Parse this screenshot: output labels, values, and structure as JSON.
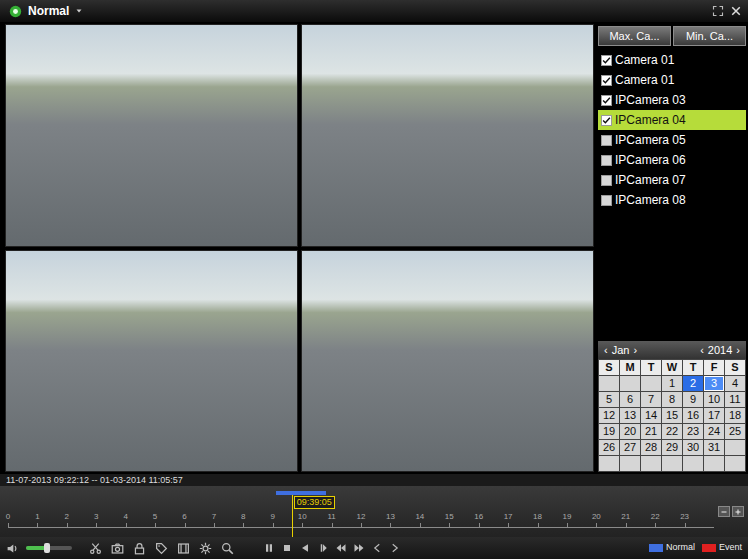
{
  "title_bar": {
    "mode": "Normal"
  },
  "camera_buttons": [
    "Max. Ca...",
    "Min. Ca..."
  ],
  "cameras": [
    {
      "label": "Camera 01",
      "checked": true,
      "selected": false
    },
    {
      "label": "Camera 01",
      "checked": true,
      "selected": false
    },
    {
      "label": "IPCamera 03",
      "checked": true,
      "selected": false
    },
    {
      "label": "IPCamera 04",
      "checked": true,
      "selected": true
    },
    {
      "label": "IPCamera 05",
      "checked": false,
      "selected": false
    },
    {
      "label": "IPCamera 06",
      "checked": false,
      "selected": false
    },
    {
      "label": "IPCamera 07",
      "checked": false,
      "selected": false
    },
    {
      "label": "IPCamera 08",
      "checked": false,
      "selected": false
    }
  ],
  "calendar": {
    "month": {
      "prev": "‹",
      "label": "Jan",
      "next": "›"
    },
    "year": {
      "prev": "‹",
      "label": "2014",
      "next": "›"
    },
    "weekdays": [
      "S",
      "M",
      "T",
      "W",
      "T",
      "F",
      "S"
    ],
    "weeks": [
      [
        {
          "day": "",
          "marked": false,
          "selected": false
        },
        {
          "day": "",
          "marked": false,
          "selected": false
        },
        {
          "day": "",
          "marked": false,
          "selected": false
        },
        {
          "day": "1",
          "marked": false,
          "selected": false
        },
        {
          "day": "2",
          "marked": true,
          "selected": false
        },
        {
          "day": "3",
          "marked": true,
          "selected": true
        },
        {
          "day": "4",
          "marked": false,
          "selected": false
        }
      ],
      [
        {
          "day": "5",
          "marked": false,
          "selected": false
        },
        {
          "day": "6",
          "marked": false,
          "selected": false
        },
        {
          "day": "7",
          "marked": false,
          "selected": false
        },
        {
          "day": "8",
          "marked": false,
          "selected": false
        },
        {
          "day": "9",
          "marked": false,
          "selected": false
        },
        {
          "day": "10",
          "marked": false,
          "selected": false
        },
        {
          "day": "11",
          "marked": false,
          "selected": false
        }
      ],
      [
        {
          "day": "12",
          "marked": false,
          "selected": false
        },
        {
          "day": "13",
          "marked": false,
          "selected": false
        },
        {
          "day": "14",
          "marked": false,
          "selected": false
        },
        {
          "day": "15",
          "marked": false,
          "selected": false
        },
        {
          "day": "16",
          "marked": false,
          "selected": false
        },
        {
          "day": "17",
          "marked": false,
          "selected": false
        },
        {
          "day": "18",
          "marked": false,
          "selected": false
        }
      ],
      [
        {
          "day": "19",
          "marked": false,
          "selected": false
        },
        {
          "day": "20",
          "marked": false,
          "selected": false
        },
        {
          "day": "21",
          "marked": false,
          "selected": false
        },
        {
          "day": "22",
          "marked": false,
          "selected": false
        },
        {
          "day": "23",
          "marked": false,
          "selected": false
        },
        {
          "day": "24",
          "marked": false,
          "selected": false
        },
        {
          "day": "25",
          "marked": false,
          "selected": false
        }
      ],
      [
        {
          "day": "26",
          "marked": false,
          "selected": false
        },
        {
          "day": "27",
          "marked": false,
          "selected": false
        },
        {
          "day": "28",
          "marked": false,
          "selected": false
        },
        {
          "day": "29",
          "marked": false,
          "selected": false
        },
        {
          "day": "30",
          "marked": false,
          "selected": false
        },
        {
          "day": "31",
          "marked": false,
          "selected": false
        },
        {
          "day": "",
          "marked": false,
          "selected": false
        }
      ],
      [
        {
          "day": "",
          "marked": false,
          "selected": false
        },
        {
          "day": "",
          "marked": false,
          "selected": false
        },
        {
          "day": "",
          "marked": false,
          "selected": false
        },
        {
          "day": "",
          "marked": false,
          "selected": false
        },
        {
          "day": "",
          "marked": false,
          "selected": false
        },
        {
          "day": "",
          "marked": false,
          "selected": false
        },
        {
          "day": "",
          "marked": false,
          "selected": false
        }
      ]
    ]
  },
  "time_range": "11-07-2013 09:22:12 -- 01-03-2014 11:05:57",
  "timeline": {
    "cursor_label": "09:39:05",
    "cursor_level": 0.402,
    "segments": [
      {
        "start": 0.38,
        "end": 0.45,
        "color": "#3f6fe0"
      }
    ],
    "ticks": [
      "0",
      "1",
      "2",
      "3",
      "4",
      "5",
      "6",
      "7",
      "8",
      "9",
      "10",
      "11",
      "12",
      "13",
      "14",
      "15",
      "16",
      "17",
      "18",
      "19",
      "20",
      "21",
      "22",
      "23"
    ]
  },
  "volume": {
    "level": 0.45
  },
  "legend": [
    {
      "label": "Normal",
      "color": "#3f6fe0"
    },
    {
      "label": "Event",
      "color": "#e02020"
    }
  ]
}
